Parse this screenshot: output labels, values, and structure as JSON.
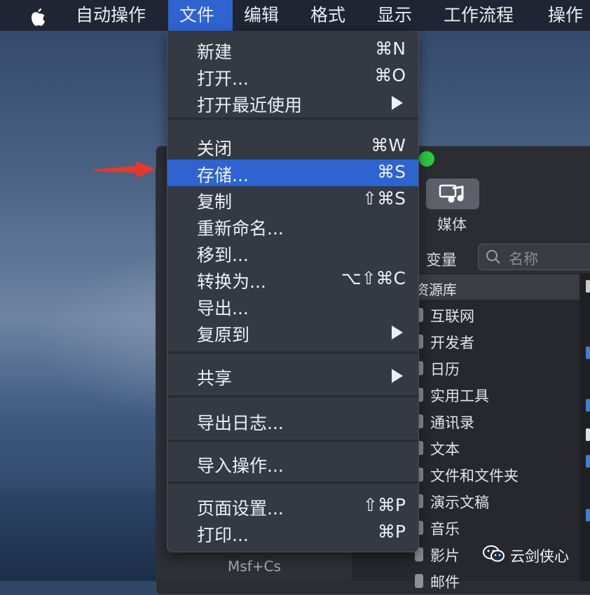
{
  "menubar": {
    "items": [
      "自动操作",
      "文件",
      "编辑",
      "格式",
      "显示",
      "工作流程",
      "操作"
    ],
    "active": "文件"
  },
  "file_menu": {
    "items": [
      {
        "label": "新建",
        "shortcut": "⌘N"
      },
      {
        "label": "打开...",
        "shortcut": "⌘O"
      },
      {
        "label": "打开最近使用",
        "submenu": true
      },
      {
        "label": "关闭",
        "shortcut": "⌘W"
      },
      {
        "label": "存储...",
        "shortcut": "⌘S",
        "highlighted": true
      },
      {
        "label": "复制",
        "shortcut": "⇧⌘S"
      },
      {
        "label": "重新命名..."
      },
      {
        "label": "移到..."
      },
      {
        "label": "转换为...",
        "shortcut": "⌥⇧⌘C"
      },
      {
        "label": "导出..."
      },
      {
        "label": "复原到",
        "submenu": true
      },
      {
        "label": "共享",
        "submenu": true
      },
      {
        "label": "导出日志..."
      },
      {
        "label": "导入操作..."
      },
      {
        "label": "页面设置...",
        "shortcut": "⇧⌘P"
      },
      {
        "label": "打印...",
        "shortcut": "⌘P"
      }
    ]
  },
  "window": {
    "media_label": "媒体",
    "variables_label": "变量",
    "search_placeholder": "名称",
    "library_title": "资源库",
    "library_items": [
      "互联网",
      "开发者",
      "日历",
      "实用工具",
      "通讯录",
      "文本",
      "文件和文件夹",
      "演示文稿",
      "音乐",
      "影片",
      "邮件"
    ],
    "footer_text": "Msf+Cs"
  },
  "watermark": "云剑侠心",
  "colors": {
    "highlight": "#2e63d0",
    "arrow": "#e8372c",
    "zoom": "#2fc841"
  }
}
